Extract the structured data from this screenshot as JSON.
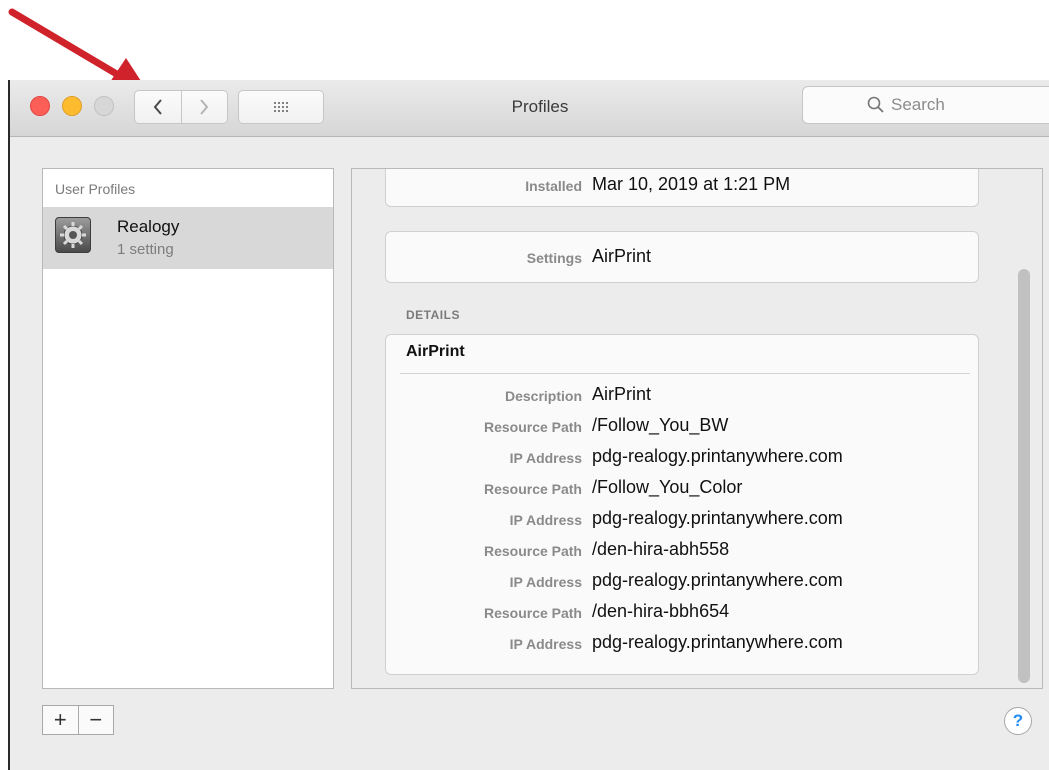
{
  "window": {
    "title": "Profiles"
  },
  "toolbar": {
    "back_icon": "chevron-left-icon",
    "forward_icon": "chevron-right-icon",
    "grid_icon": "grid-icon",
    "search_placeholder": "Search"
  },
  "sidebar": {
    "header": "User Profiles",
    "items": [
      {
        "name": "Realogy",
        "subtitle": "1 setting",
        "icon": "gear-icon"
      }
    ]
  },
  "detail": {
    "installed_label": "Installed",
    "installed_value": "Mar 10, 2019 at 1:21 PM",
    "settings_label": "Settings",
    "settings_value": "AirPrint",
    "details_header": "DETAILS",
    "section_title": "AirPrint",
    "rows": [
      {
        "label": "Description",
        "value": "AirPrint"
      },
      {
        "label": "Resource Path",
        "value": "/Follow_You_BW"
      },
      {
        "label": "IP Address",
        "value": "pdg-realogy.printanywhere.com"
      },
      {
        "label": "Resource Path",
        "value": "/Follow_You_Color"
      },
      {
        "label": "IP Address",
        "value": "pdg-realogy.printanywhere.com"
      },
      {
        "label": "Resource Path",
        "value": "/den-hira-abh558"
      },
      {
        "label": "IP Address",
        "value": "pdg-realogy.printanywhere.com"
      },
      {
        "label": "Resource Path",
        "value": "/den-hira-bbh654"
      },
      {
        "label": "IP Address",
        "value": "pdg-realogy.printanywhere.com"
      }
    ]
  },
  "footer": {
    "add_label": "+",
    "remove_label": "−",
    "help_label": "?"
  },
  "colors": {
    "annotation_arrow": "#d0222a",
    "help_accent": "#1f8cf5"
  }
}
